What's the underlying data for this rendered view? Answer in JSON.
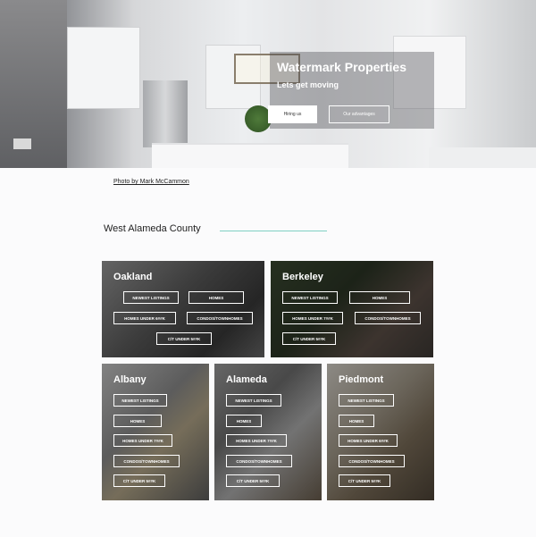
{
  "hero": {
    "title": "Watermark Properties",
    "subtitle": "Lets get moving",
    "primary_button": "Hiring us",
    "secondary_button": "Our advantages",
    "credit": "Photo by Mark McCammon"
  },
  "section": {
    "title": "West Alameda County",
    "accent_color": "#7fd0c3"
  },
  "cards": [
    {
      "name": "Oakland",
      "buttons": [
        "NEWEST LISTINGS",
        "HOMES",
        "HOMES UNDER 6##K",
        "CONDOS/TOWNHOMES",
        "C/T UNDER 5##K"
      ]
    },
    {
      "name": "Berkeley",
      "buttons": [
        "NEWEST LISTINGS",
        "HOMES",
        "HOMES UNDER 7##K",
        "CONDOS/TOWNHOMES",
        "C/T UNDER 5##K"
      ]
    },
    {
      "name": "Albany",
      "buttons": [
        "NEWEST LISTINGS",
        "HOMES",
        "HOMES UNDER 7##K",
        "CONDOS/TOWNHOMES",
        "C/T UNDER 5##K"
      ]
    },
    {
      "name": "Alameda",
      "buttons": [
        "NEWEST LISTINGS",
        "HOMES",
        "HOMES UNDER 7##K",
        "CONDOS/TOWNHOMES",
        "C/T UNDER 5##K"
      ]
    },
    {
      "name": "Piedmont",
      "buttons": [
        "NEWEST LISTINGS",
        "HOMES",
        "HOMES UNDER 6##K",
        "CONDOS/TOWNHOMES",
        "C/T UNDER 5##K"
      ]
    }
  ]
}
